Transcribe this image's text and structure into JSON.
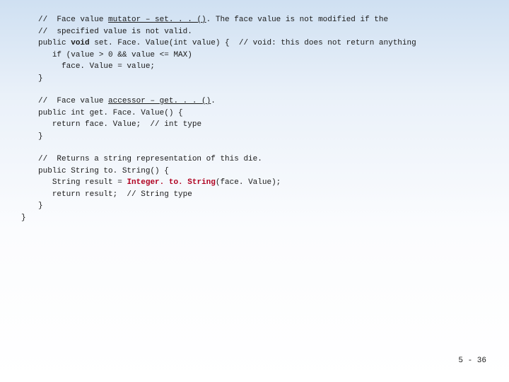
{
  "code": {
    "block1": {
      "cmt_prefix1": "//  Face value ",
      "cmt_under1": "mutator – set. . . ()",
      "cmt_suffix1": ". The face value is not modified if the",
      "cmt2": "//  specified value is not valid.",
      "sig_pre": "public ",
      "sig_kw": "void",
      "sig_post": " set. Face. Value(int value) {  // void: this does not return anything",
      "if_line": "   if (value > 0 && value <= MAX)",
      "assign_line": "     face. Value = value;",
      "close": "}"
    },
    "block2": {
      "cmt_prefix": "//  Face value ",
      "cmt_under": "accessor – get. . . ()",
      "cmt_suffix": ".",
      "sig": "public int get. Face. Value() {",
      "ret": "   return face. Value;  // int type",
      "close": "}"
    },
    "block3": {
      "cmt": "//  Returns a string representation of this die.",
      "sig": "public String to. String() {",
      "res_pre": "   String result = ",
      "res_red": "Integer. to. String",
      "res_post": "(face. Value);",
      "ret": "   return result;  // String type",
      "close": "}",
      "outer_close": "}"
    }
  },
  "footer": "5 - 36"
}
